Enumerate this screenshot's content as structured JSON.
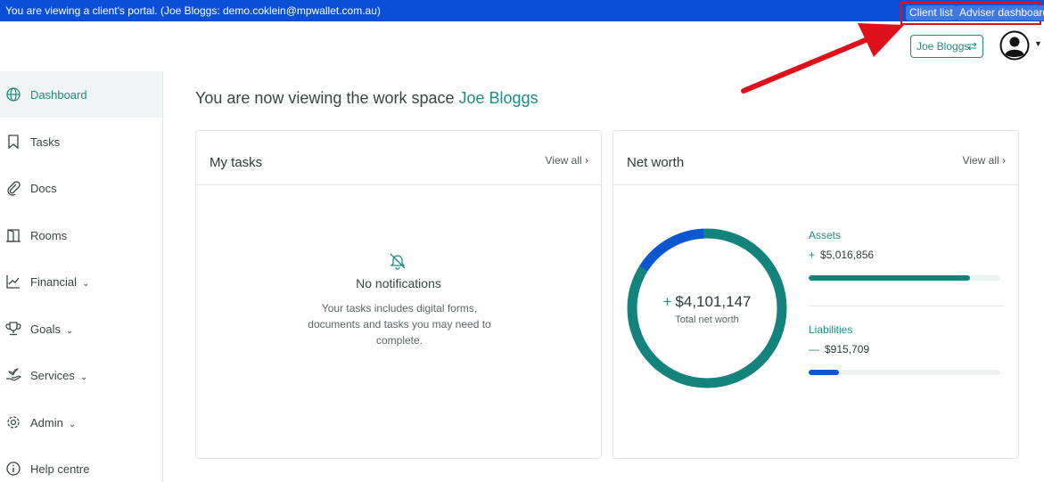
{
  "banner": {
    "text": "You are viewing a client's portal. (Joe Bloggs:  demo.coklein@mpwallet.com.au)",
    "client_list": "Client list",
    "adviser_dashboard": "Adviser dashboard"
  },
  "header": {
    "user_switch_label": "Joe Bloggs",
    "user_switch_icon": "⇄"
  },
  "sidebar": {
    "items": [
      {
        "label": "Dashboard",
        "icon": "globe-icon",
        "chevron": "",
        "active": true
      },
      {
        "label": "Tasks",
        "icon": "bookmark-icon",
        "chevron": ""
      },
      {
        "label": "Docs",
        "icon": "paperclip-icon",
        "chevron": ""
      },
      {
        "label": "Rooms",
        "icon": "door-icon",
        "chevron": ""
      },
      {
        "label": "Financial",
        "icon": "chart-icon",
        "chevron": "⌄"
      },
      {
        "label": "Goals",
        "icon": "trophy-icon",
        "chevron": "⌄"
      },
      {
        "label": "Services",
        "icon": "hand-icon",
        "chevron": "⌄"
      },
      {
        "label": "Admin",
        "icon": "gear-icon",
        "chevron": "⌄"
      },
      {
        "label": "Help centre",
        "icon": "info-icon",
        "chevron": ""
      }
    ]
  },
  "main": {
    "title_prefix": "You are now viewing the work space ",
    "title_name": "Joe Bloggs",
    "tasks_card": {
      "title": "My tasks",
      "view_all": "View all ›",
      "empty_title": "No notifications",
      "empty_desc": "Your tasks includes digital forms, documents and tasks you may need to complete."
    },
    "networth_card": {
      "title": "Net worth",
      "view_all": "View all ›",
      "total_sign": "+",
      "total_value": "$4,101,147",
      "total_label": "Total net worth",
      "assets_label": "Assets",
      "assets_sign": "+",
      "assets_value": "$5,016,856",
      "liabilities_label": "Liabilities",
      "liabilities_sign": "—",
      "liabilities_value": "$915,709",
      "assets_bar_fraction": 0.84,
      "liabilities_bar_fraction": 0.16,
      "donut_liability_fraction": 0.154
    }
  },
  "colors": {
    "banner": "#0b4fd6",
    "accent": "#1e8a83",
    "assets": "#14837c",
    "liabilities": "#0b57d0",
    "annotation": "#e0101a"
  }
}
